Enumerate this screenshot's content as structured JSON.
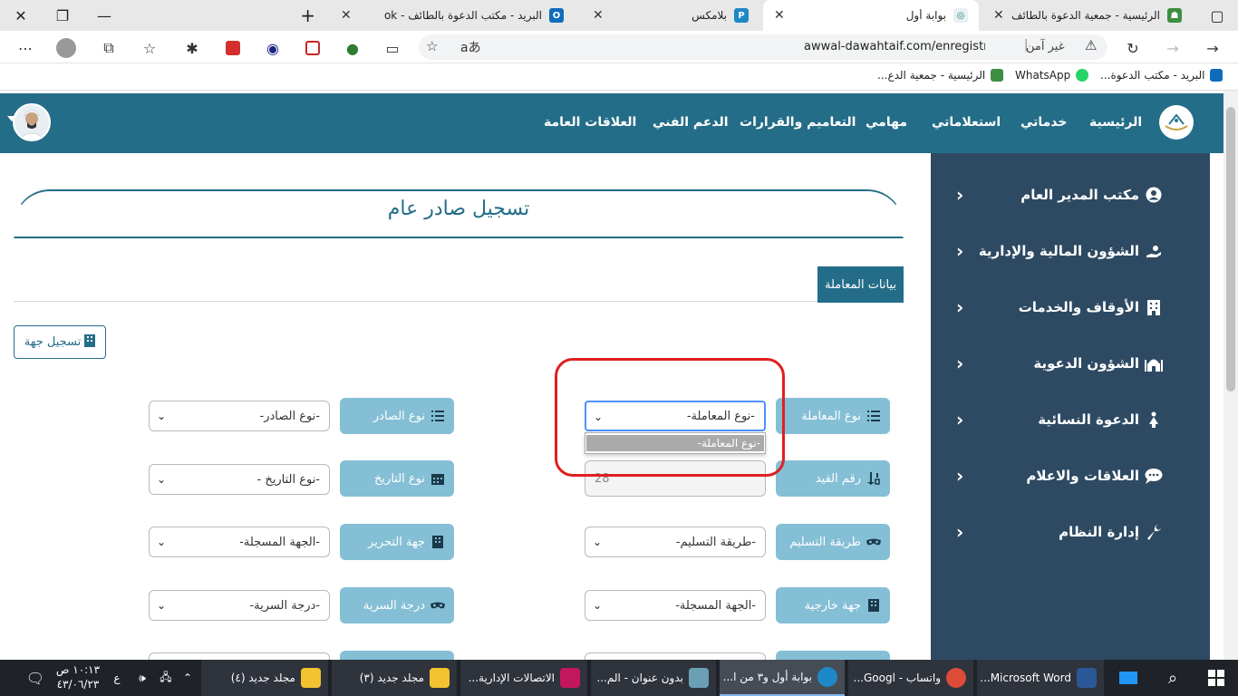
{
  "browser": {
    "tabs": [
      {
        "title": "الرئيسية - جمعية الدعوة بالطائف",
        "active": false,
        "color": "#3e8e41"
      },
      {
        "title": "بوابة أول",
        "active": true,
        "color": "#2a7a8f"
      },
      {
        "title": "بلامكس",
        "active": false,
        "color": "#1e88c7"
      },
      {
        "title": "البريد - مكتب الدعوة بالطائف - ok",
        "active": false,
        "color": "#0f6cbd"
      }
    ],
    "url": "awwal-dawahtaif.com/enregistrer-tre",
    "not_secure": "غير آمن",
    "bookmarks": [
      "البريد - مكتب الدعوة...",
      "WhatsApp",
      "الرئيسية - جمعية الدع..."
    ]
  },
  "navbar": {
    "items": [
      "الرئيسية",
      "خدماتي",
      "استعلاماتي",
      "مهامي",
      "التعاميم والقرارات",
      "الدعم الفني",
      "العلاقات العامة"
    ]
  },
  "sidebar": {
    "items": [
      {
        "label": "مكتب المدير العام",
        "icon": "user-circle-icon"
      },
      {
        "label": "الشؤون المالية والإدارية",
        "icon": "hand-money-icon"
      },
      {
        "label": "الأوقاف والخدمات",
        "icon": "building-icon"
      },
      {
        "label": "الشؤون الدعوية",
        "icon": "mosque-icon"
      },
      {
        "label": "الدعوة النسائية",
        "icon": "female-icon"
      },
      {
        "label": "العلاقات والاعلام",
        "icon": "chat-icon"
      },
      {
        "label": "إدارة النظام",
        "icon": "wrench-icon"
      }
    ]
  },
  "page": {
    "title": "تسجيل صادر عام",
    "section_tab": "بيانات المعاملة",
    "register_button": "تسجيل جهة"
  },
  "form": {
    "transaction_type": {
      "label": "نوع المعاملة",
      "value": "-نوع المعاملة-"
    },
    "outgoing_type": {
      "label": "نوع الصادر",
      "value": "-نوع الصادر-"
    },
    "record_number": {
      "label": "رقم القيد",
      "value": "28"
    },
    "date_type": {
      "label": "نوع التاريخ",
      "value": "-نوع التاريخ -"
    },
    "delivery_method": {
      "label": "طريقة التسليم",
      "value": "-طريقة التسليم-"
    },
    "issuing_party": {
      "label": "جهة التحرير",
      "value": "-الجهة المسجلة-"
    },
    "external_party": {
      "label": "جهة خارجية",
      "value": "-الجهة المسجلة-"
    },
    "confidentiality": {
      "label": "درجة السرية",
      "value": "-درجة السرية-"
    },
    "dropdown_option": "-نوع المعاملة-"
  },
  "taskbar": {
    "items": [
      {
        "label": "Microsoft Word...",
        "color": "#2b5797"
      },
      {
        "label": "واتساب - Googl...",
        "color": "#dd4b39"
      },
      {
        "label": "بوابة أول و٣ من ا...",
        "color": "#1e88c7"
      },
      {
        "label": "بدون عنوان - الم...",
        "color": "#6a9fb5"
      },
      {
        "label": "الاتصالات الإدارية...",
        "color": "#c2185b"
      },
      {
        "label": "مجلد جديد (٣)",
        "color": "#f2c230"
      },
      {
        "label": "مجلد جديد (٤)",
        "color": "#f2c230"
      }
    ],
    "lang": "ع",
    "time": "١٠:١٣ ص",
    "date": "٤٣/٠٦/٢٣"
  }
}
